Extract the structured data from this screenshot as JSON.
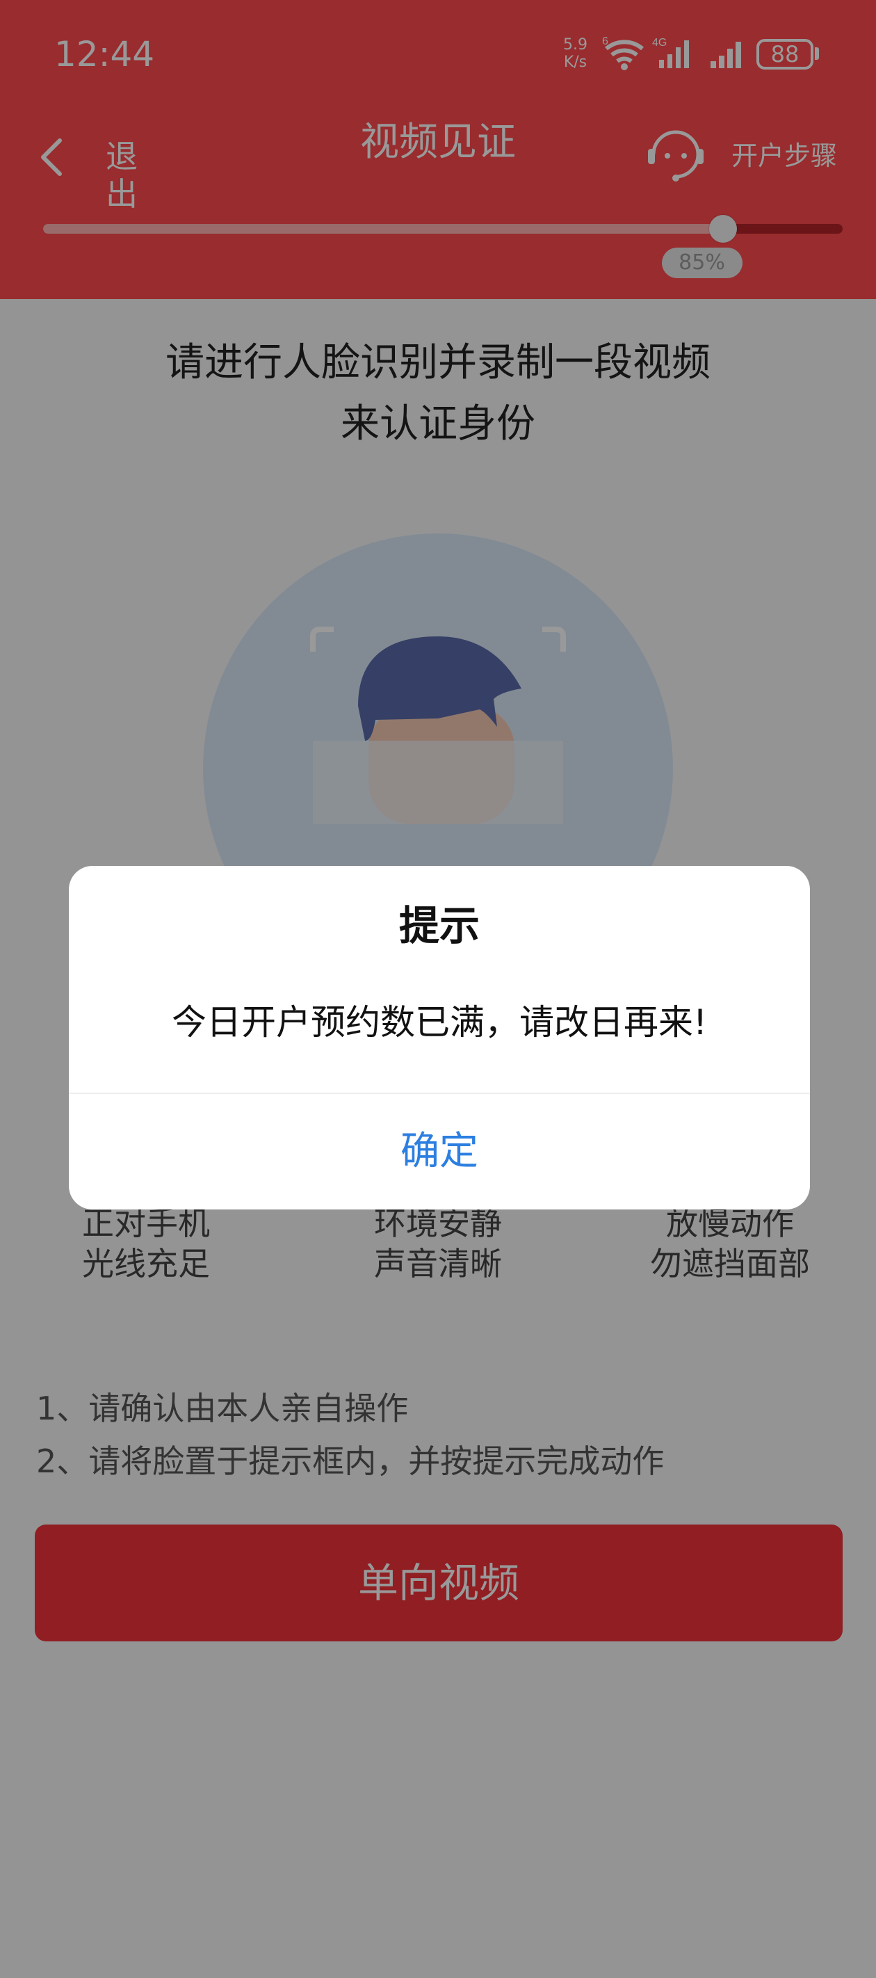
{
  "status_bar": {
    "time": "12:44",
    "net_speed_value": "5.9",
    "net_speed_unit": "K/s",
    "wifi_label": "6",
    "cell_label": "4G",
    "battery": "88"
  },
  "header": {
    "back_label": "退出",
    "title": "视频见证",
    "steps_label": "开户步骤",
    "progress_percent": 85,
    "progress_text": "85%"
  },
  "main": {
    "instruction_line1": "请进行人脸识别并录制一段视频",
    "instruction_line2": "来认证身份",
    "tips": [
      {
        "line1": "正对手机",
        "line2": "光线充足"
      },
      {
        "line1": "环境安静",
        "line2": "声音清晰"
      },
      {
        "line1": "放慢动作",
        "line2": "勿遮挡面部"
      }
    ],
    "notes": [
      "1、请确认由本人亲自操作",
      "2、请将脸置于提示框内，并按提示完成动作"
    ],
    "button_label": "单向视频"
  },
  "dialog": {
    "title": "提示",
    "message": "今日开户预约数已满，请改日再来!",
    "confirm_label": "确定"
  },
  "colors": {
    "brand_red": "#ff4a4d",
    "link_blue": "#2c7fe0"
  }
}
